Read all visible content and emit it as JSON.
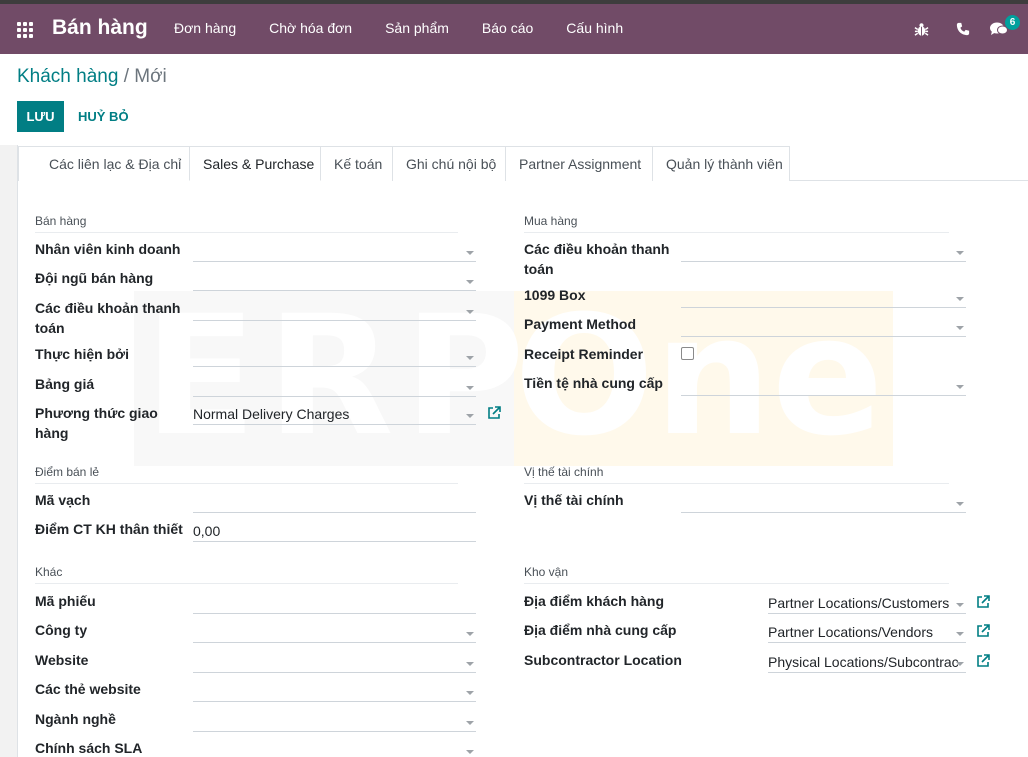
{
  "header": {
    "app_name": "Bán hàng",
    "menu": [
      "Đơn hàng",
      "Chờ hóa đơn",
      "Sản phẩm",
      "Báo cáo",
      "Cấu hình"
    ],
    "chat_count": "6"
  },
  "breadcrumb": {
    "parent": "Khách hàng",
    "separator": "/",
    "current": "Mới"
  },
  "actions": {
    "save": "LƯU",
    "discard": "HUỶ BỎ"
  },
  "tabs": [
    "Các liên lạc & Địa chỉ",
    "Sales & Purchase",
    "Kế toán",
    "Ghi chú nội bộ",
    "Partner Assignment",
    "Quản lý thành viên"
  ],
  "active_tab": "Sales & Purchase",
  "watermark": "ERP One",
  "sales": {
    "title": "Bán hàng",
    "salesperson": "Nhân viên kinh doanh",
    "sales_team": "Đội ngũ bán hàng",
    "payment_terms_1": "Các điều khoản thanh",
    "payment_terms_2": "toán",
    "fulfilled_by": "Thực hiện bởi",
    "pricelist": "Bảng giá",
    "delivery_method_1": "Phương thức giao",
    "delivery_method_2": "hàng",
    "delivery_method_value": "Normal Delivery Charges"
  },
  "purchase": {
    "title": "Mua hàng",
    "payment_terms_1": "Các điều khoản thanh",
    "payment_terms_2": "toán",
    "box_1099": "1099 Box",
    "payment_method": "Payment Method",
    "receipt_reminder": "Receipt Reminder",
    "supplier_currency": "Tiền tệ nhà cung cấp"
  },
  "pos": {
    "title": "Điểm bán lẻ",
    "barcode": "Mã vạch",
    "loyalty_points": "Điểm CT KH thân thiết",
    "loyalty_points_value": "0,00"
  },
  "fiscal": {
    "title": "Vị thế tài chính",
    "fiscal_position": "Vị thế tài chính"
  },
  "misc": {
    "title": "Khác",
    "reference": "Mã phiếu",
    "company": "Công ty",
    "website": "Website",
    "website_tags": "Các thẻ website",
    "industry": "Ngành nghề",
    "sla_policy": "Chính sách SLA"
  },
  "inventory": {
    "title": "Kho vận",
    "customer_location": "Địa điểm khách hàng",
    "customer_location_value": "Partner Locations/Customers",
    "vendor_location": "Địa điểm nhà cung cấp",
    "vendor_location_value": "Partner Locations/Vendors",
    "subcontractor_location": "Subcontractor Location",
    "subcontractor_location_value": "Physical Locations/Subcontrac"
  },
  "colors": {
    "topbar": "#714b67",
    "accent": "#017e84",
    "badge": "#00a09d"
  },
  "icons": [
    "apps-grid-icon",
    "bug-icon",
    "phone-icon",
    "chat-icon",
    "external-link-icon",
    "caret-down-icon"
  ]
}
